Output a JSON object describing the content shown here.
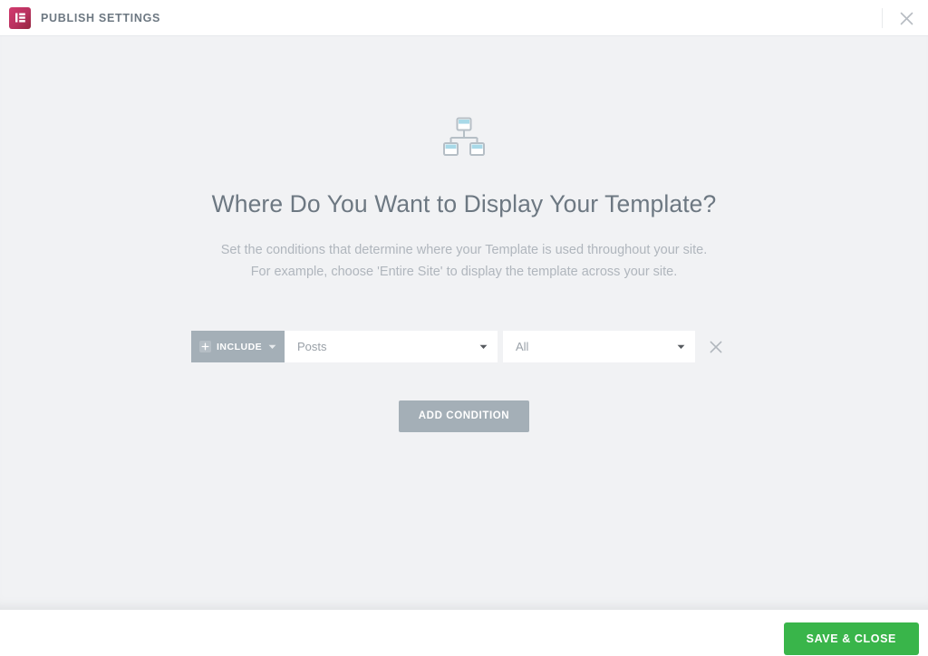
{
  "header": {
    "logo_icon": "elementor-logo-icon",
    "title": "PUBLISH SETTINGS",
    "close_icon": "close-icon"
  },
  "hero": {
    "icon": "sitemap-icon",
    "title": "Where Do You Want to Display Your Template?",
    "description_line1": "Set the conditions that determine where your Template is used throughout your site.",
    "description_line2": "For example, choose 'Entire Site' to display the template across your site."
  },
  "conditions": [
    {
      "type": {
        "plus_icon": "plus-icon",
        "label": "INCLUDE",
        "caret_icon": "chevron-down-icon"
      },
      "object": {
        "value": "Posts",
        "caret_icon": "chevron-down-icon"
      },
      "scope": {
        "value": "All",
        "caret_icon": "chevron-down-icon"
      },
      "remove_icon": "close-icon"
    }
  ],
  "actions": {
    "add_condition_label": "ADD CONDITION",
    "save_close_label": "SAVE & CLOSE"
  },
  "colors": {
    "brand_pink": "#b8325f",
    "body_background": "#f1f2f4",
    "control_gray": "#a4afb7",
    "save_green": "#39b54a",
    "title_text": "#6d7882",
    "muted_text": "#b0b6bd",
    "icon_accent": "#a8d9e8"
  }
}
